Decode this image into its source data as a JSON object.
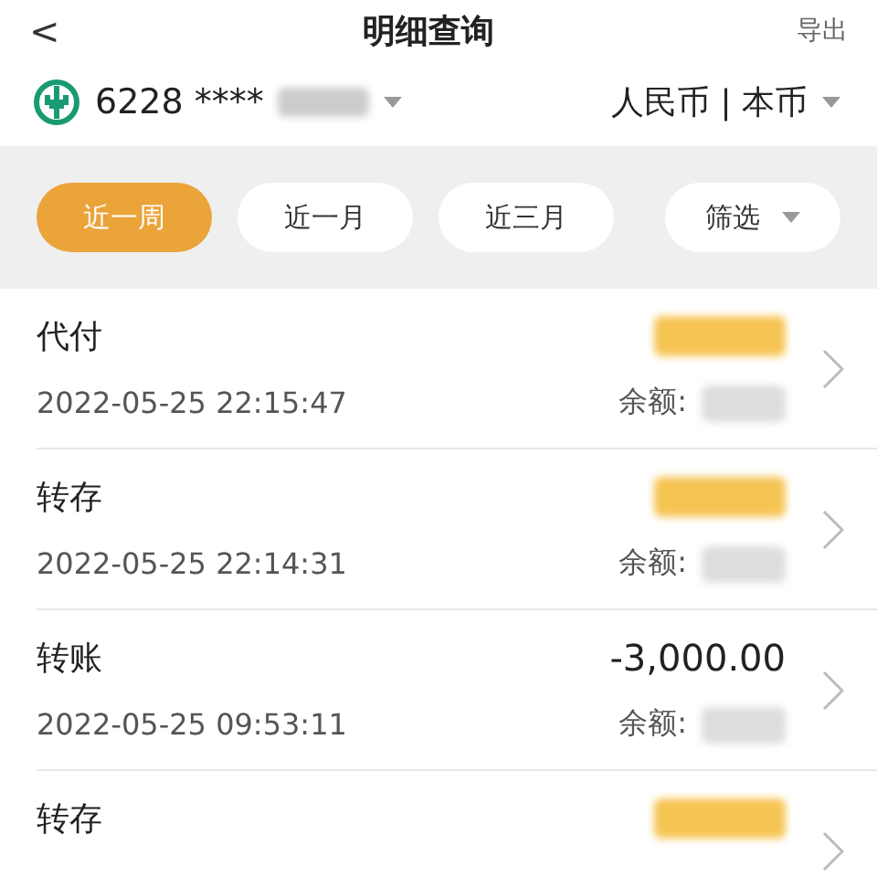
{
  "header": {
    "back": "<",
    "title": "明细查询",
    "action": "导出"
  },
  "account": {
    "number": "6228 ****",
    "currency": "人民币 | 本币"
  },
  "filters": [
    {
      "label": "近一周",
      "selected": true,
      "kind": "period"
    },
    {
      "label": "近一月",
      "selected": false,
      "kind": "period"
    },
    {
      "label": "近三月",
      "selected": false,
      "kind": "period"
    },
    {
      "label": "筛选",
      "selected": false,
      "kind": "dropdown"
    }
  ],
  "transactions": [
    {
      "type": "代付",
      "time": "2022-05-25 22:15:47",
      "color": "#f6c453",
      "balance_label": "余额:"
    },
    {
      "type": "转存",
      "time": "2022-05-25 22:14:31",
      "color": "#f6c453",
      "balance_label": "余额:"
    },
    {
      "type": "转账",
      "time": "2022-05-25 09:53:11",
      "amount": "-3,000.00",
      "balance_label": "余额:"
    },
    {
      "type": "转存",
      "color": "#f6c453"
    }
  ]
}
